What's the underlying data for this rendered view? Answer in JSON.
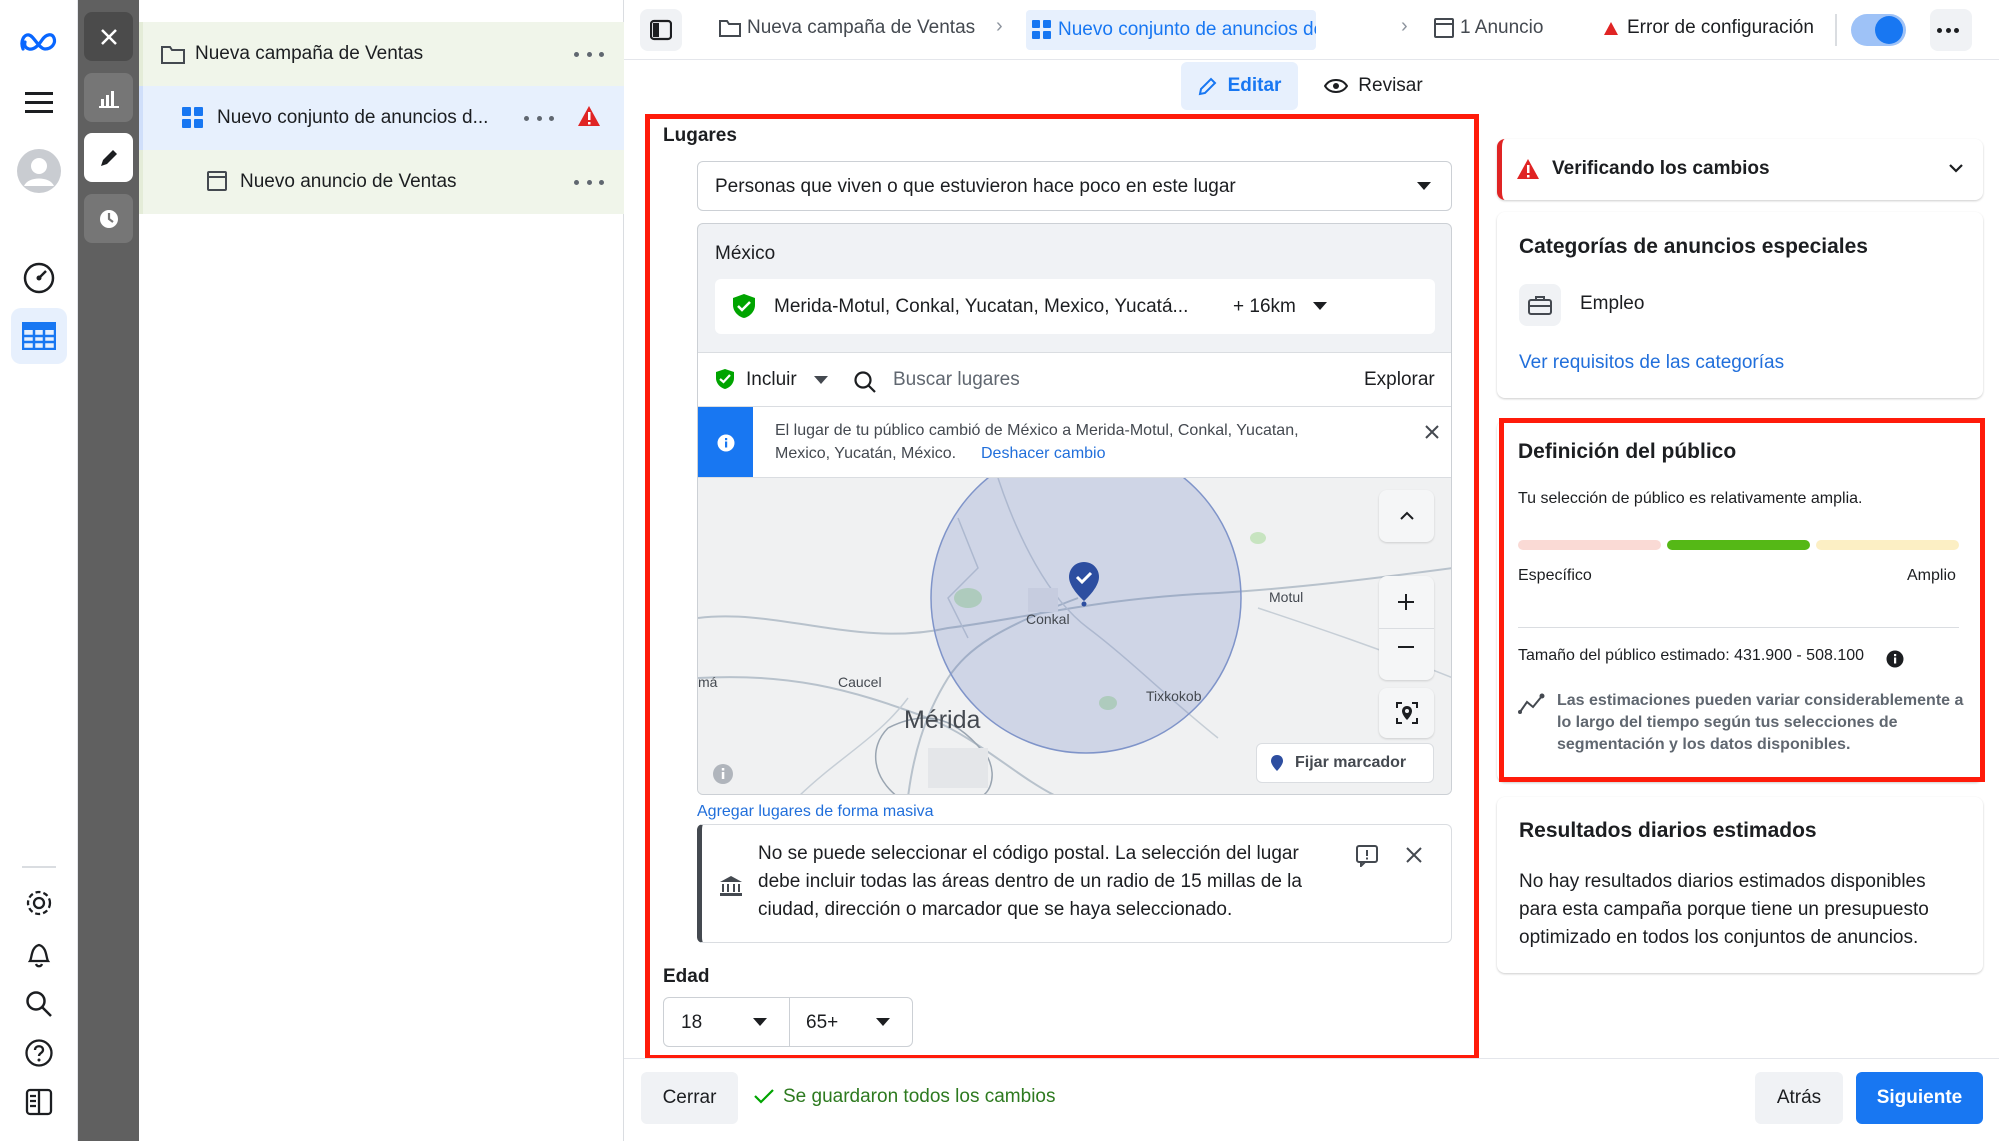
{
  "colors": {
    "accent": "#1877f2",
    "red_outline": "#ff1b0a",
    "error": "#e0245e",
    "success": "#31a24c",
    "link": "#216fdb"
  },
  "tree": {
    "campaign": "Nueva campaña de Ventas",
    "adset": "Nuevo conjunto de anuncios d...",
    "ad": "Nuevo anuncio de Ventas"
  },
  "topbar": {
    "crumb_campaign": "Nueva campaña de Ventas",
    "crumb_adset": "Nuevo conjunto de anuncios de Ventas",
    "crumb_ad": "1 Anuncio",
    "error": "Error de configuración",
    "tab_edit": "Editar",
    "tab_review": "Revisar"
  },
  "places": {
    "heading": "Lugares",
    "dropdown": "Personas que viven o que estuvieron hace poco en este lugar",
    "country": "México",
    "location": "Merida-Motul, Conkal, Yucatan, Mexico, Yucatá...",
    "radius": "+ 16km",
    "include": "Incluir",
    "search_placeholder": "Buscar lugares",
    "explore": "Explorar",
    "notice_text_1": "El lugar de tu público cambió de México a Merida-Motul, Conkal, Yucatan,",
    "notice_text_2": "Mexico, Yucatán, México.",
    "notice_undo": "Deshacer cambio",
    "map_labels": {
      "conkal": "Conkal",
      "motul": "Motul",
      "caucel": "Caucel",
      "merida": "Mérida",
      "tixkokob": "Tixkokob",
      "ma": "má"
    },
    "pin_button": "Fijar marcador",
    "bulk_link": "Agregar lugares de forma masiva",
    "warning_1": "No se puede seleccionar el código postal. La selección del lugar",
    "warning_2": "debe incluir todas las áreas dentro de un radio de 15 millas de la",
    "warning_3": "ciudad, dirección o marcador que se haya seleccionado."
  },
  "age": {
    "heading": "Edad",
    "min": "18",
    "max": "65+"
  },
  "footer": {
    "close": "Cerrar",
    "saved": "Se guardaron todos los cambios",
    "back": "Atrás",
    "next": "Siguiente"
  },
  "right": {
    "verifying": "Verificando los cambios",
    "special_title": "Categorías de anuncios especiales",
    "employment": "Empleo",
    "requirements_link": "Ver requisitos de las categorías",
    "audience_title": "Definición del público",
    "audience_desc": "Tu selección de público es relativamente amplia.",
    "specific": "Específico",
    "broad": "Amplio",
    "audience_level": 0.5,
    "size": "Tamaño del público estimado: 431.900 - 508.100",
    "estimate_1": "Las estimaciones pueden variar considerablemente a",
    "estimate_2": "lo largo del tiempo según tus selecciones de",
    "estimate_3": "segmentación y los datos disponibles.",
    "results_title": "Resultados diarios estimados",
    "results_1": "No hay resultados diarios estimados disponibles",
    "results_2": "para esta campaña porque tiene un presupuesto",
    "results_3": "optimizado en todos los conjuntos de anuncios."
  }
}
